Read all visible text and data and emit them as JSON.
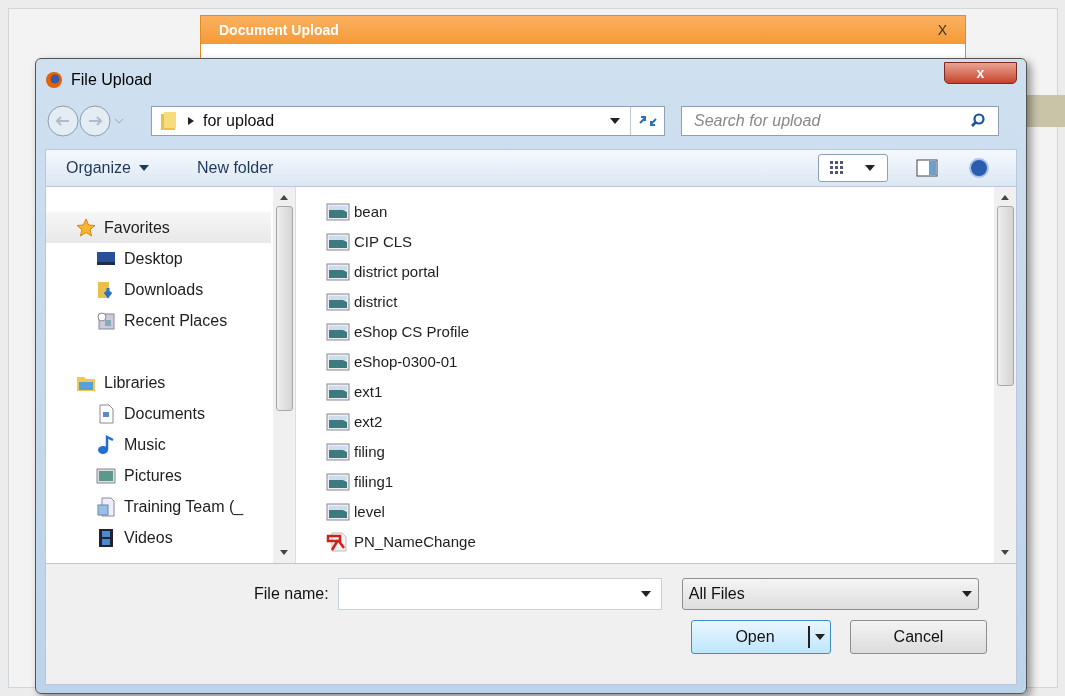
{
  "background_dialog": {
    "title": "Document Upload",
    "close": "X"
  },
  "window": {
    "title": "File Upload",
    "close": "x"
  },
  "address_bar": {
    "path": "for upload"
  },
  "search": {
    "placeholder": "Search for upload"
  },
  "toolbar": {
    "organize": "Organize",
    "new_folder": "New folder"
  },
  "navigation": [
    {
      "kind": "favorites",
      "label": "Favorites",
      "children": [
        {
          "kind": "desktop",
          "label": "Desktop"
        },
        {
          "kind": "downloads",
          "label": "Downloads"
        },
        {
          "kind": "recent",
          "label": "Recent Places"
        }
      ]
    },
    {
      "kind": "libraries",
      "label": "Libraries",
      "children": [
        {
          "kind": "documents",
          "label": "Documents"
        },
        {
          "kind": "music",
          "label": "Music"
        },
        {
          "kind": "pictures",
          "label": "Pictures"
        },
        {
          "kind": "library",
          "label": "Training Team (_"
        },
        {
          "kind": "videos",
          "label": "Videos"
        }
      ]
    }
  ],
  "files": [
    {
      "kind": "image",
      "name": "bean"
    },
    {
      "kind": "image",
      "name": "CIP CLS"
    },
    {
      "kind": "image",
      "name": "district portal"
    },
    {
      "kind": "image",
      "name": "district"
    },
    {
      "kind": "image",
      "name": "eShop CS Profile"
    },
    {
      "kind": "image",
      "name": "eShop-0300-01"
    },
    {
      "kind": "image",
      "name": "ext1"
    },
    {
      "kind": "image",
      "name": "ext2"
    },
    {
      "kind": "image",
      "name": "filing"
    },
    {
      "kind": "image",
      "name": "filing1"
    },
    {
      "kind": "image",
      "name": "level"
    },
    {
      "kind": "pdf",
      "name": "PN_NameChange"
    }
  ],
  "file_name": {
    "label": "File name:"
  },
  "file_type": "All Files",
  "buttons": {
    "open": "Open",
    "cancel": "Cancel"
  }
}
